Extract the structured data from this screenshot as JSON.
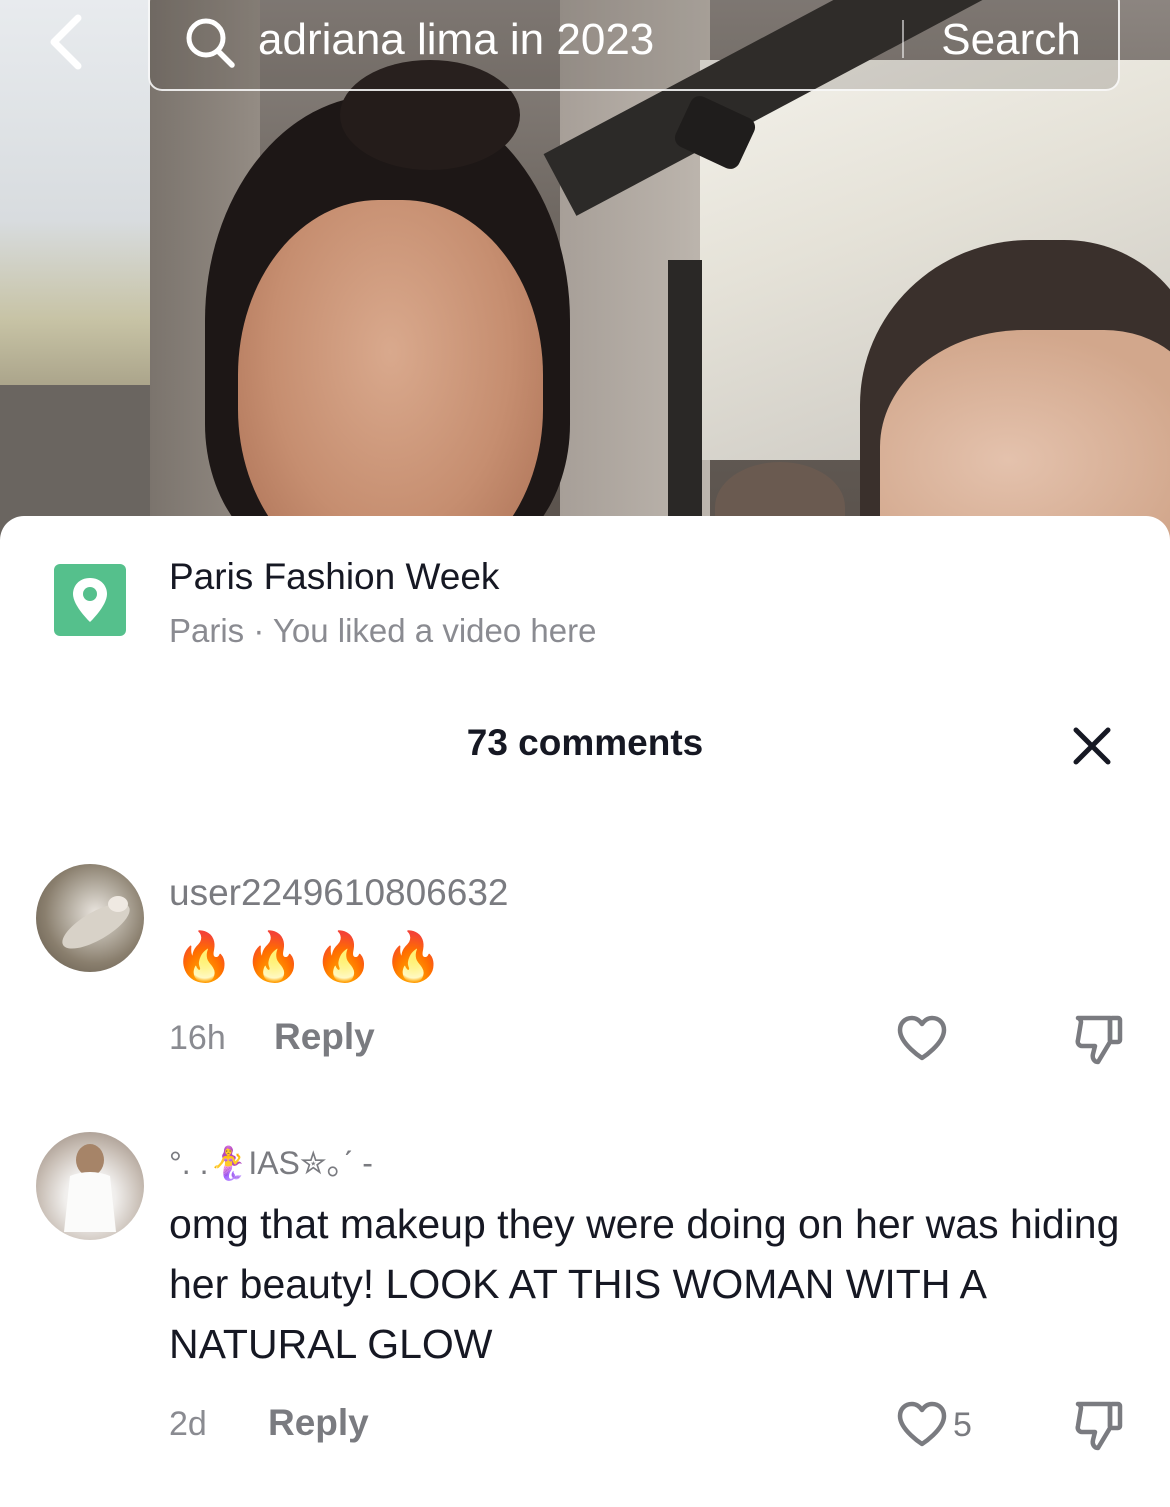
{
  "search": {
    "query": "adriana lima in 2023",
    "button_label": "Search"
  },
  "location": {
    "title": "Paris Fashion Week",
    "subtitle": "Paris · You liked a video here"
  },
  "comments_header": {
    "count_label": "73 comments"
  },
  "comments": [
    {
      "username": "user2249610806632",
      "text": "🔥🔥🔥🔥",
      "time": "16h",
      "reply_label": "Reply",
      "likes": ""
    },
    {
      "username": "°.  .🧜‍♀️IAS✮｡ˊ -",
      "text": "omg that makeup they were doing on her was hiding her beauty! LOOK AT THIS WOMAN WITH A NATURAL GLOW",
      "time": "2d",
      "reply_label": "Reply",
      "likes": "5"
    }
  ],
  "icons": {
    "back": "chevron-left-icon",
    "search": "search-icon",
    "location": "location-pin-icon",
    "close": "close-icon",
    "like": "heart-outline-icon",
    "dislike": "thumbs-down-icon"
  },
  "colors": {
    "location_badge": "#55c08c",
    "text_primary": "#161823",
    "text_secondary": "#8a8b91"
  }
}
